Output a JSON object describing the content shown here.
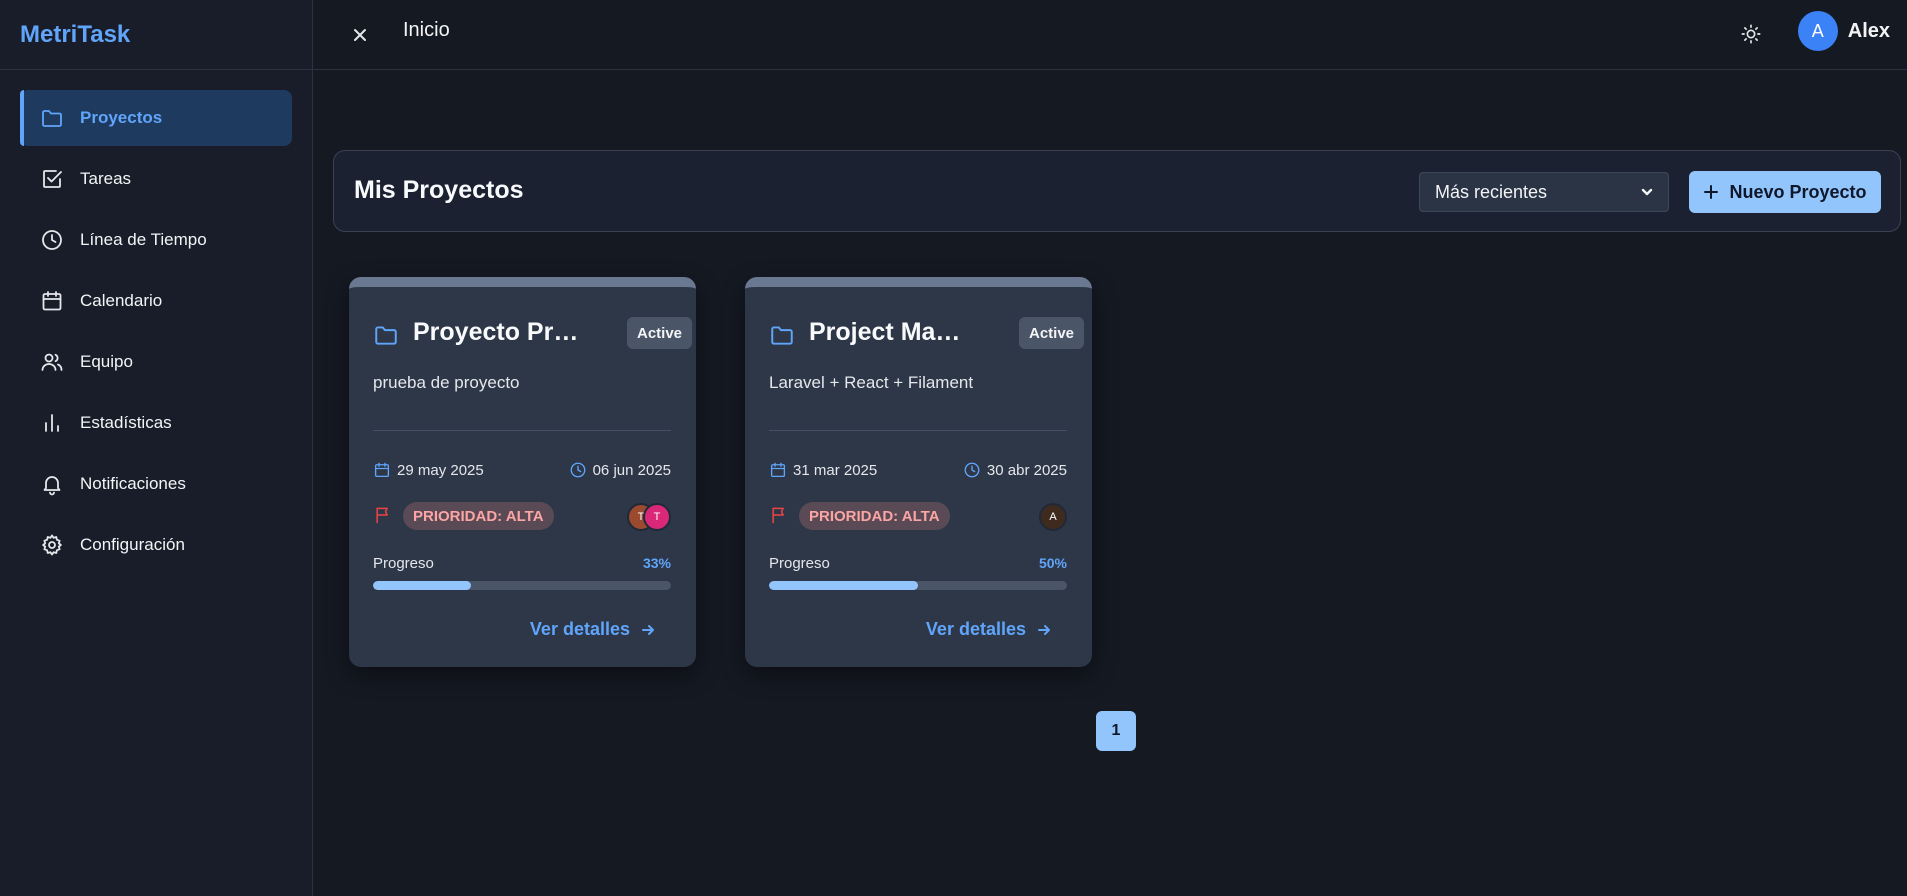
{
  "app": {
    "brand": "MetriTask"
  },
  "topbar": {
    "page_title": "Inicio",
    "user_initial": "A",
    "user_name": "Alex"
  },
  "sidebar": {
    "items": [
      {
        "label": "Proyectos",
        "icon": "folder-icon",
        "active": true
      },
      {
        "label": "Tareas",
        "icon": "checkbox-icon",
        "active": false
      },
      {
        "label": "Línea de Tiempo",
        "icon": "clock-icon",
        "active": false
      },
      {
        "label": "Calendario",
        "icon": "calendar-icon",
        "active": false
      },
      {
        "label": "Equipo",
        "icon": "users-icon",
        "active": false
      },
      {
        "label": "Estadísticas",
        "icon": "bar-chart-icon",
        "active": false
      },
      {
        "label": "Notificaciones",
        "icon": "bell-icon",
        "active": false
      },
      {
        "label": "Configuración",
        "icon": "gear-icon",
        "active": false
      }
    ]
  },
  "header": {
    "title": "Mis Proyectos",
    "sort_value": "Más recientes",
    "new_button_label": "Nuevo Proyecto"
  },
  "projects": [
    {
      "title": "Proyecto Pr…",
      "status": "Active",
      "description": "prueba de proyecto",
      "start_date": "29 may 2025",
      "end_date": "06 jun 2025",
      "priority": "PRIORIDAD: ALTA",
      "members": [
        {
          "initial": "T",
          "color": "#9c4a2f"
        },
        {
          "initial": "T",
          "color": "#db2777"
        }
      ],
      "progress_label": "Progreso",
      "progress_text": "33%",
      "progress": 0.33,
      "link_label": "Ver detalles"
    },
    {
      "title": "Project Ma…",
      "status": "Active",
      "description": "Laravel + React + Filament",
      "start_date": "31 mar 2025",
      "end_date": "30 abr 2025",
      "priority": "PRIORIDAD: ALTA",
      "members": [
        {
          "initial": "A",
          "color": "#3f2b1d"
        }
      ],
      "progress_label": "Progreso",
      "progress_text": "50%",
      "progress": 0.5,
      "link_label": "Ver detalles"
    }
  ],
  "pagination": {
    "current": "1"
  },
  "colors": {
    "accent": "#60a5fa",
    "button": "#93c5fd",
    "priority_high": "#fca5a5",
    "background": "#151922"
  }
}
